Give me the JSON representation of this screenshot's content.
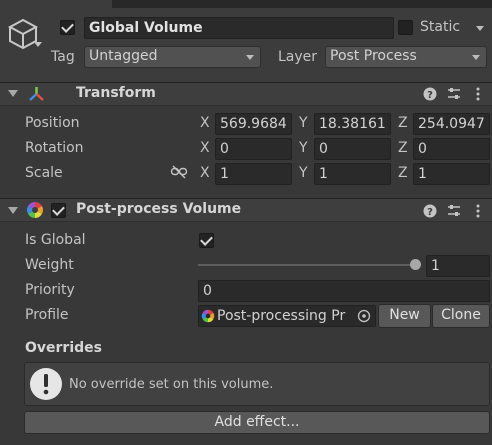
{
  "gameobject": {
    "name": "Global Volume",
    "active": true,
    "static_label": "Static",
    "static_checked": false,
    "tag_label": "Tag",
    "tag_value": "Untagged",
    "layer_label": "Layer",
    "layer_value": "Post Process"
  },
  "transform": {
    "title": "Transform",
    "rows": [
      {
        "label": "Position",
        "x": "569.9684",
        "y": "18.38161",
        "z": "254.0947"
      },
      {
        "label": "Rotation",
        "x": "0",
        "y": "0",
        "z": "0"
      },
      {
        "label": "Scale",
        "x": "1",
        "y": "1",
        "z": "1"
      }
    ],
    "axes": {
      "x": "X",
      "y": "Y",
      "z": "Z"
    }
  },
  "ppvolume": {
    "title": "Post-process Volume",
    "enabled": true,
    "is_global_label": "Is Global",
    "is_global": true,
    "weight_label": "Weight",
    "weight_value": "1",
    "weight_fraction": 1.0,
    "priority_label": "Priority",
    "priority_value": "0",
    "profile_label": "Profile",
    "profile_value": "Post-processing Pr",
    "new_label": "New",
    "clone_label": "Clone",
    "overrides_label": "Overrides",
    "no_override_text": "No override set on this volume.",
    "add_effect_label": "Add effect..."
  },
  "colors": {
    "background": "#383838",
    "field": "#2a2a2a",
    "button": "#585858"
  }
}
